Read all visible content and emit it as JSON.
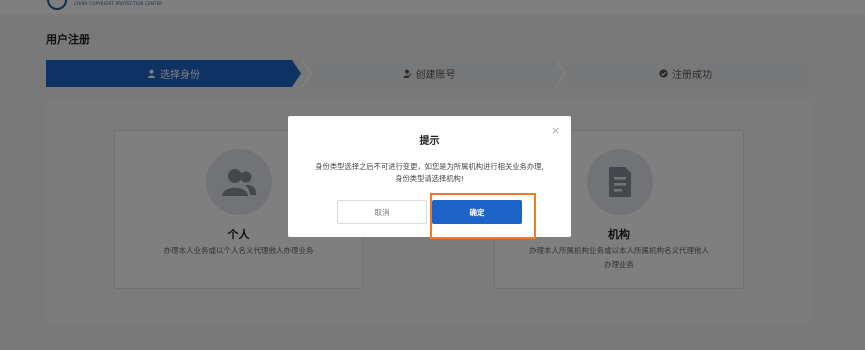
{
  "header": {
    "logo_text": "CHINA COPYRIGHT PROTECTION CENTER",
    "logo_sub": "",
    "top_right": ""
  },
  "page": {
    "title": "用户注册"
  },
  "steps": [
    {
      "label": "选择身份",
      "icon": "user-icon",
      "active": true
    },
    {
      "label": "创建账号",
      "icon": "user-edit-icon",
      "active": false
    },
    {
      "label": "注册成功",
      "icon": "check-circle-icon",
      "active": false
    }
  ],
  "cards": {
    "personal": {
      "title": "个人",
      "desc": "办理本人业务或以个人名义代理他人办理业务",
      "icon": "users-icon"
    },
    "org": {
      "title": "机构",
      "desc_line1": "办理本人所属机构业务或以本人所属机构名义代理他人",
      "desc_line2": "办理业务",
      "icon": "document-icon"
    }
  },
  "modal": {
    "title": "提示",
    "close": "×",
    "body_line1": "身份类型选择之后不可进行变更，如您是为所属机构进行相关业务办理,",
    "body_line2": "身份类型请选择机构!",
    "cancel": "取消",
    "confirm": "确定"
  },
  "colors": {
    "primary": "#1c64c8",
    "highlight": "#f07a2a"
  }
}
